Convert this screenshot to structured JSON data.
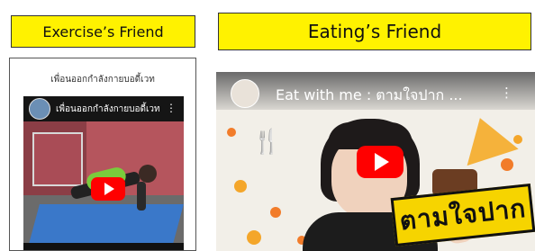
{
  "left": {
    "header": "Exercise’s Friend",
    "caption": "เพื่อนออกกำลังกายบอดี้เวท",
    "video_title": "เพื่อนออกกำลังกายบอดี้เวท",
    "menu_icon": "⋮"
  },
  "right": {
    "header": "Eating’s Friend",
    "video_title": "Eat with me : ตามใจปาก ...",
    "menu_icon": "⋮",
    "stamp_text": "ตามใจปาก"
  },
  "colors": {
    "header_yellow": "#fff200",
    "play_red": "#ff0000"
  },
  "icons": {
    "play": "play-icon",
    "menu": "more-vert-icon",
    "fork": "fork-knife-icon"
  }
}
